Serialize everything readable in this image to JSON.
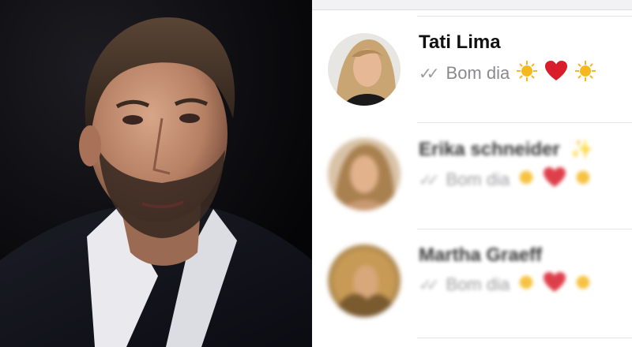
{
  "chats": [
    {
      "name": "Tati Lima",
      "message": "Bom dia",
      "ticks_icon": "double-check-icon",
      "emojis": [
        "sun-icon",
        "heart-icon",
        "sun-icon"
      ]
    },
    {
      "name": "Erika schneider",
      "name_suffix_icon": "sparkle-icon",
      "message": "Bom dia",
      "ticks_icon": "double-check-icon",
      "emojis": [
        "sun-icon",
        "heart-icon",
        "sun-icon"
      ]
    },
    {
      "name": "Martha Graeff",
      "message": "Bom dia",
      "ticks_icon": "double-check-icon",
      "emojis": [
        "sun-icon",
        "heart-icon",
        "sun-icon"
      ]
    }
  ],
  "colors": {
    "heart": "#d81e2b",
    "sun": "#f5b821",
    "ticks": "#9a9aa0",
    "name": "#111111",
    "message": "#8a8a8e"
  }
}
